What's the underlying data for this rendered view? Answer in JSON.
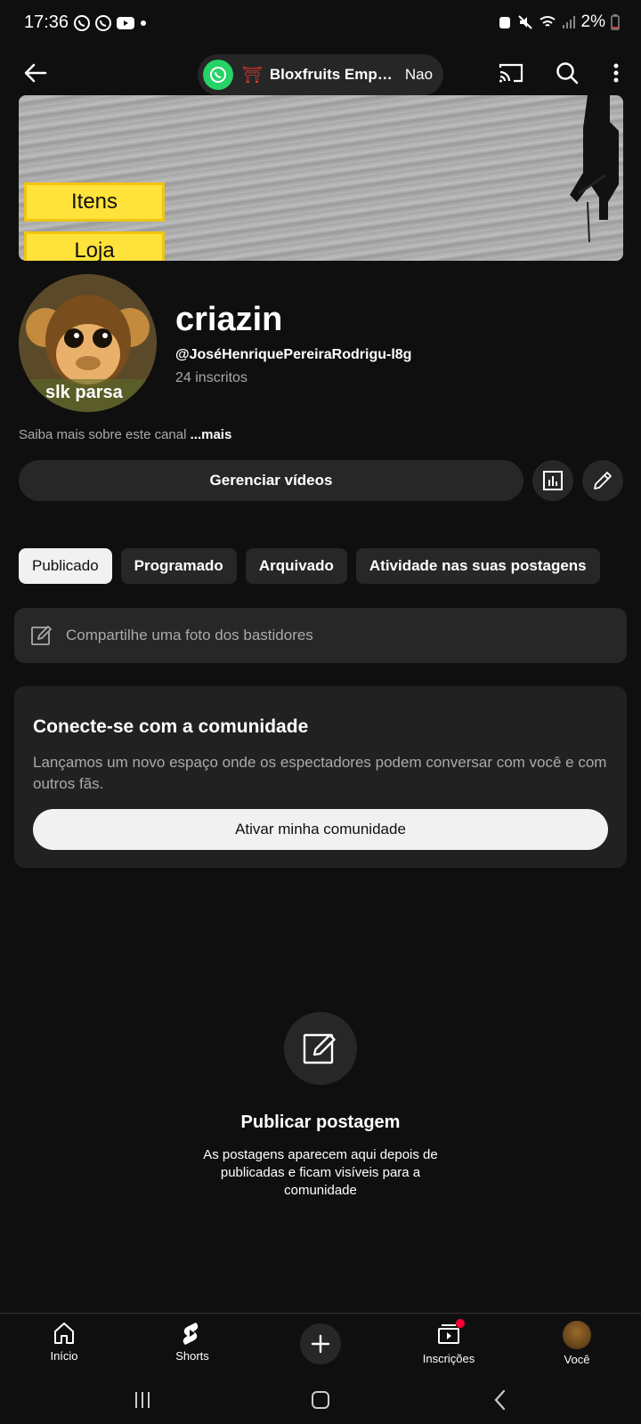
{
  "status_bar": {
    "time": "17:36",
    "battery": "2%"
  },
  "top_bar": {
    "whatsapp_title": "Bloxfruits Empir...",
    "whatsapp_sub": "Nao"
  },
  "banner": {
    "btn1": "Itens",
    "btn2": "Loja"
  },
  "avatar": {
    "label": "slk parsa"
  },
  "channel": {
    "name": "criazin",
    "handle": "@JoséHenriquePereiraRodrigu-l8g",
    "subscribers": "24 inscritos",
    "about": "Saiba mais sobre este canal",
    "about_more": "...mais"
  },
  "actions": {
    "manage_videos": "Gerenciar vídeos"
  },
  "tabs": [
    {
      "label": "Publicado"
    },
    {
      "label": "Programado"
    },
    {
      "label": "Arquivado"
    },
    {
      "label": "Atividade nas suas postagens"
    }
  ],
  "share": {
    "placeholder": "Compartilhe uma foto dos bastidores"
  },
  "community": {
    "title": "Conecte-se com a comunidade",
    "body": "Lançamos um novo espaço onde os espectadores podem conversar com você e com outros fãs.",
    "button": "Ativar minha comunidade"
  },
  "empty_state": {
    "title": "Publicar postagem",
    "body": "As postagens aparecem aqui depois de publicadas e ficam visíveis para a comunidade"
  },
  "bottom_nav": {
    "home": "Início",
    "shorts": "Shorts",
    "subscriptions": "Inscrições",
    "you": "Você"
  },
  "colors": {
    "background": "#0f0f0f",
    "surface": "#272727",
    "whatsapp": "#25d366",
    "notification": "#ff0033"
  }
}
